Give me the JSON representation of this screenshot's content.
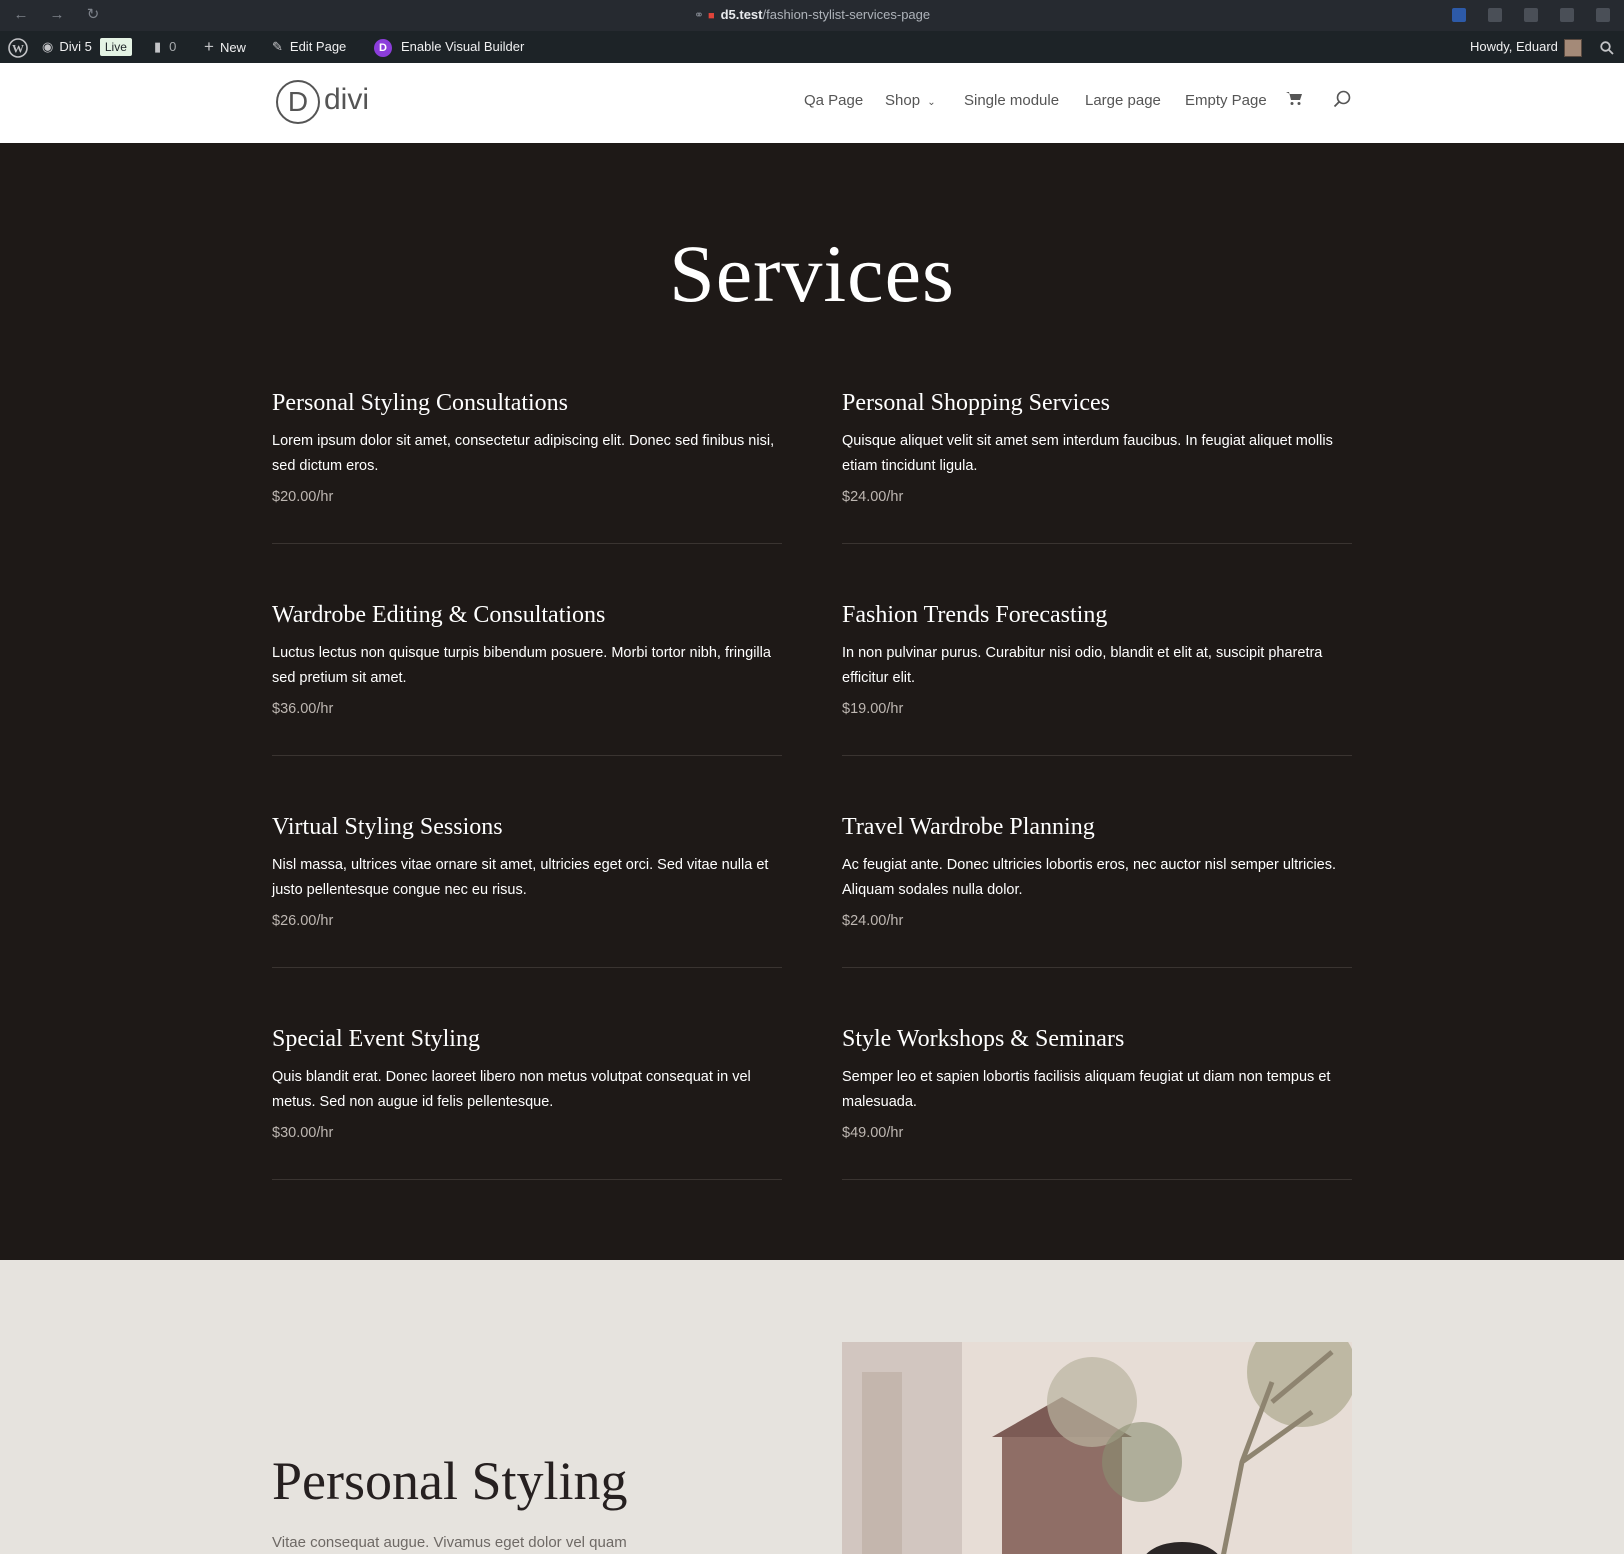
{
  "browser": {
    "url_host": "d5.test",
    "url_path": "/fashion-stylist-services-page"
  },
  "adminbar": {
    "site_name": "Divi 5",
    "live_badge": "Live",
    "comments_count": "0",
    "new_label": "New",
    "edit_label": "Edit Page",
    "visual_builder_label": "Enable Visual Builder",
    "howdy": "Howdy, Eduard"
  },
  "header": {
    "logo_letter": "D",
    "logo_text": "divi",
    "menu": [
      "Qa Page",
      "Shop",
      "Single module",
      "Large page",
      "Empty Page"
    ]
  },
  "services": {
    "title": "Services",
    "items": [
      {
        "title": "Personal Styling Consultations",
        "desc": "Lorem ipsum dolor sit amet, consectetur adipiscing elit. Donec sed finibus nisi, sed dictum eros.",
        "price": "$20.00/hr"
      },
      {
        "title": "Personal Shopping Services",
        "desc": "Quisque aliquet velit sit amet sem interdum faucibus. In feugiat aliquet mollis etiam tincidunt ligula.",
        "price": "$24.00/hr"
      },
      {
        "title": "Wardrobe Editing & Consultations",
        "desc": "Luctus lectus non quisque turpis bibendum posuere. Morbi tortor nibh, fringilla sed pretium sit amet.",
        "price": "$36.00/hr"
      },
      {
        "title": "Fashion Trends Forecasting",
        "desc": "In non pulvinar purus. Curabitur nisi odio, blandit et elit at, suscipit pharetra efficitur elit.",
        "price": "$19.00/hr"
      },
      {
        "title": "Virtual Styling Sessions",
        "desc": "Nisl massa, ultrices vitae ornare sit amet, ultricies eget orci. Sed vitae nulla et justo pellentesque congue nec eu risus.",
        "price": "$26.00/hr"
      },
      {
        "title": "Travel Wardrobe Planning",
        "desc": "Ac feugiat ante. Donec ultricies lobortis eros, nec auctor nisl semper ultricies. Aliquam sodales nulla dolor.",
        "price": "$24.00/hr"
      },
      {
        "title": "Special Event Styling",
        "desc": "Quis blandit erat. Donec laoreet libero non metus volutpat consequat in vel metus. Sed non augue id felis pellentesque.",
        "price": "$30.00/hr"
      },
      {
        "title": "Style Workshops & Seminars",
        "desc": "Semper leo et sapien lobortis facilisis aliquam feugiat ut diam non tempus et malesuada.",
        "price": "$49.00/hr"
      }
    ]
  },
  "about": {
    "title": "Personal Styling",
    "text": "Vitae consequat augue. Vivamus eget dolor vel quam"
  },
  "colors": {
    "dark_bg": "#1e1917",
    "light_bg": "#e6e3de",
    "accent_divi": "#8c3ddb"
  }
}
